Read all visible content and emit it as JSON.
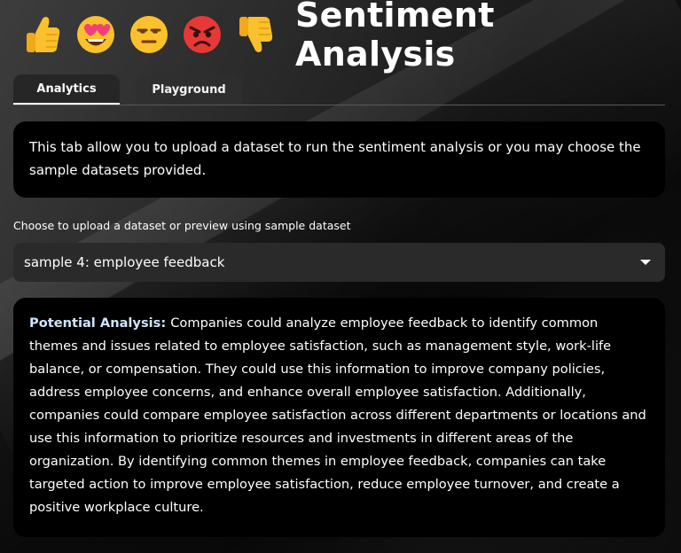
{
  "header": {
    "title": "Sentiment Analysis",
    "emojis": [
      "thumbs-up-icon",
      "heart-eyes-icon",
      "neutral-face-icon",
      "angry-face-icon",
      "thumbs-down-icon"
    ]
  },
  "tabs": [
    {
      "label": "Analytics",
      "active": true
    },
    {
      "label": "Playground",
      "active": false
    }
  ],
  "intro": {
    "text": "This tab allow you to upload a dataset to run the sentiment analysis or you may choose the sample datasets provided."
  },
  "dataset_select": {
    "label": "Choose to upload a dataset or preview using sample dataset",
    "selected": "sample 4: employee feedback"
  },
  "analysis": {
    "label": "Potential Analysis:",
    "text": "Companies could analyze employee feedback to identify common themes and issues related to employee satisfaction, such as management style, work-life balance, or compensation. They could use this information to improve company policies, address employee concerns, and enhance overall employee satisfaction. Additionally, companies could compare employee satisfaction across different departments or locations and use this information to prioritize resources and investments in different areas of the organization. By identifying common themes in employee feedback, companies can take targeted action to improve employee satisfaction, reduce employee turnover, and create a positive workplace culture."
  },
  "colors": {
    "card_bg": "#000000",
    "select_bg": "#2a2a2a",
    "accent_label": "#cfe5ff"
  }
}
